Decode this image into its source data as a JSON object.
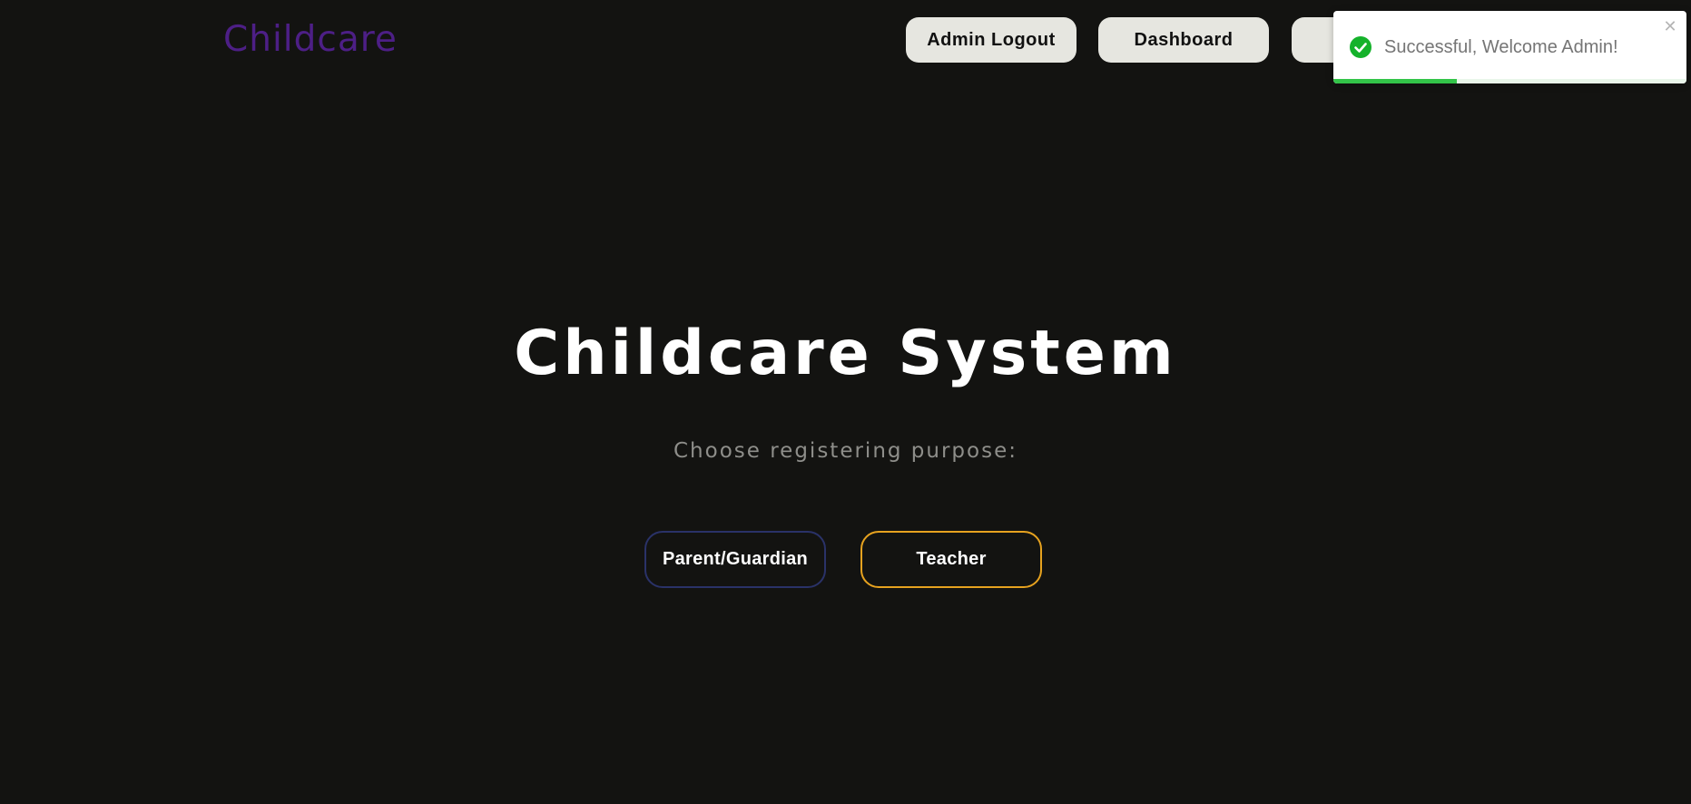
{
  "header": {
    "logo_text": "Childcare",
    "buttons": {
      "logout_label": "Admin Logout",
      "dashboard_label": "Dashboard"
    }
  },
  "main": {
    "title": "Childcare System",
    "subtitle": "Choose registering purpose:",
    "options": {
      "parent_label": "Parent/Guardian",
      "teacher_label": "Teacher"
    }
  },
  "toast": {
    "message": "Successful, Welcome Admin!",
    "icon": "check-circle-icon",
    "close_icon": "close-icon",
    "progress_fraction": 0.35
  },
  "colors": {
    "background": "#131311",
    "logo": "#4d1f86",
    "nav_button_bg": "#e6e6e0",
    "parent_border": "#2a3268",
    "teacher_border": "#e6a21f",
    "toast_success": "#33c449"
  }
}
